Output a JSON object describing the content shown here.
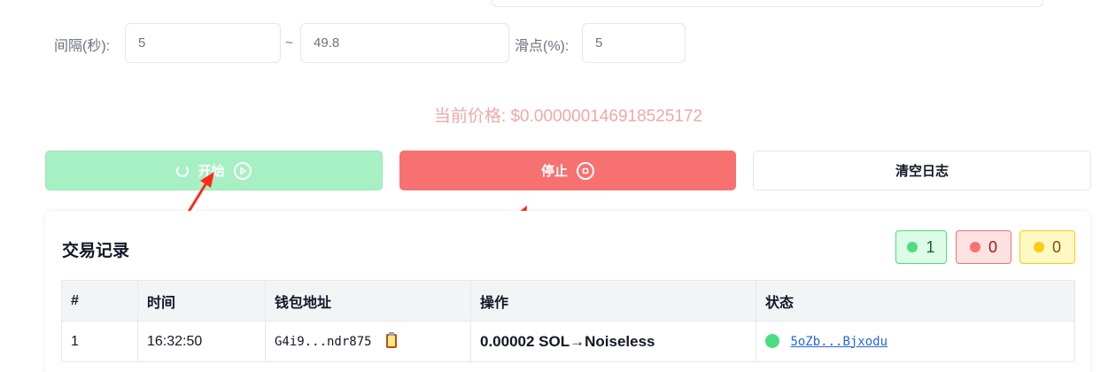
{
  "params": {
    "interval_label": "间隔(秒):",
    "interval_min": "5",
    "range_sep": "~",
    "interval_max": "49.8",
    "slippage_label": "滑点(%):",
    "slippage": "5"
  },
  "price_text": "当前价格: $0.000000146918525172",
  "buttons": {
    "start": "开始",
    "stop": "停止",
    "clear": "清空日志"
  },
  "log": {
    "title": "交易记录",
    "counts": {
      "success": "1",
      "failed": "0",
      "pending": "0"
    },
    "columns": [
      "#",
      "时间",
      "钱包地址",
      "操作",
      "状态"
    ],
    "rows": [
      {
        "index": "1",
        "time": "16:32:50",
        "wallet": "G4i9...ndr875",
        "action": "0.00002 SOL→Noiseless",
        "tx": "5oZb...Bjxodu"
      }
    ]
  },
  "colors": {
    "start_bg": "#a7f0c3",
    "stop_bg": "#f87171",
    "price": "#f0a8a8",
    "success": "#4ade80",
    "annotation_arrow": "#ff2a1a"
  }
}
